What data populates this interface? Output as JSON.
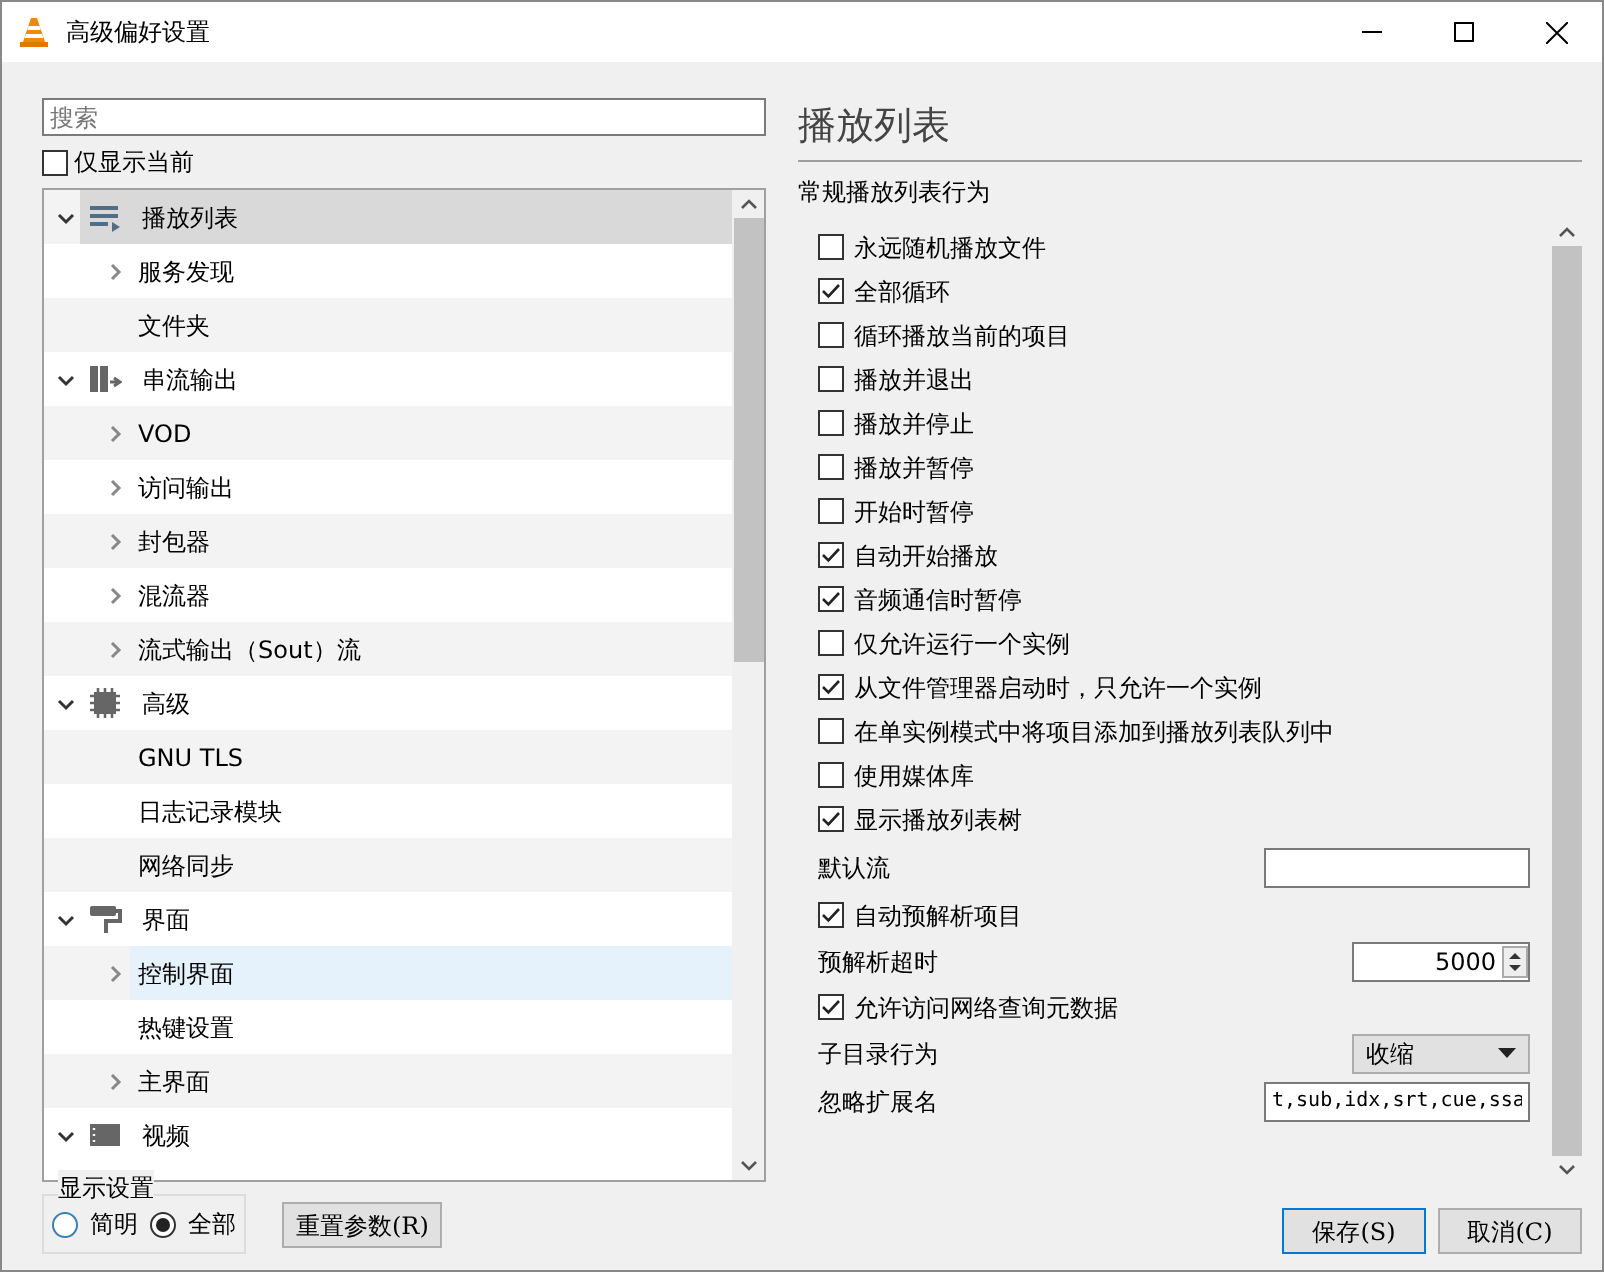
{
  "window": {
    "title": "高级偏好设置"
  },
  "search": {
    "placeholder": "搜索"
  },
  "show_current_only": {
    "label": "仅显示当前",
    "checked": false
  },
  "tree": [
    {
      "label": "播放列表",
      "expanded": true,
      "selected": true,
      "hovered": false,
      "children": [
        {
          "label": "服务发现",
          "expanded": false,
          "selected": false,
          "hovered": false
        },
        {
          "label": "文件夹",
          "selected": false,
          "hovered": false
        }
      ]
    },
    {
      "label": "串流输出",
      "expanded": true,
      "selected": false,
      "hovered": false,
      "children": [
        {
          "label": "VOD",
          "expanded": false,
          "selected": false,
          "hovered": false
        },
        {
          "label": "访问输出",
          "expanded": false,
          "selected": false,
          "hovered": false
        },
        {
          "label": "封包器",
          "expanded": false,
          "selected": false,
          "hovered": false
        },
        {
          "label": "混流器",
          "expanded": false,
          "selected": false,
          "hovered": false
        },
        {
          "label": "流式输出（Sout）流",
          "expanded": false,
          "selected": false,
          "hovered": false
        }
      ]
    },
    {
      "label": "高级",
      "expanded": true,
      "selected": false,
      "hovered": false,
      "children": [
        {
          "label": "GNU TLS",
          "selected": false,
          "hovered": false
        },
        {
          "label": "日志记录模块",
          "selected": false,
          "hovered": false
        },
        {
          "label": "网络同步",
          "selected": false,
          "hovered": false
        }
      ]
    },
    {
      "label": "界面",
      "expanded": true,
      "selected": false,
      "hovered": false,
      "children": [
        {
          "label": "控制界面",
          "expanded": false,
          "selected": false,
          "hovered": true
        },
        {
          "label": "热键设置",
          "selected": false,
          "hovered": false
        },
        {
          "label": "主界面",
          "expanded": false,
          "selected": false,
          "hovered": false
        }
      ]
    },
    {
      "label": "视频",
      "expanded": true,
      "selected": false,
      "hovered": false
    }
  ],
  "display_settings": {
    "title": "显示设置",
    "options": [
      {
        "label": "简明",
        "selected": false
      },
      {
        "label": "全部",
        "selected": true
      }
    ]
  },
  "reset_button": "重置参数(R)",
  "panel": {
    "title": "播放列表",
    "section": "常规播放列表行为",
    "items": [
      {
        "kind": "checkbox",
        "label": "永远随机播放文件",
        "checked": false
      },
      {
        "kind": "checkbox",
        "label": "全部循环",
        "checked": true
      },
      {
        "kind": "checkbox",
        "label": "循环播放当前的项目",
        "checked": false
      },
      {
        "kind": "checkbox",
        "label": "播放并退出",
        "checked": false
      },
      {
        "kind": "checkbox",
        "label": "播放并停止",
        "checked": false
      },
      {
        "kind": "checkbox",
        "label": "播放并暂停",
        "checked": false
      },
      {
        "kind": "checkbox",
        "label": "开始时暂停",
        "checked": false
      },
      {
        "kind": "checkbox",
        "label": "自动开始播放",
        "checked": true
      },
      {
        "kind": "checkbox",
        "label": "音频通信时暂停",
        "checked": true
      },
      {
        "kind": "checkbox",
        "label": "仅允许运行一个实例",
        "checked": false
      },
      {
        "kind": "checkbox",
        "label": "从文件管理器启动时，只允许一个实例",
        "checked": true
      },
      {
        "kind": "checkbox",
        "label": "在单实例模式中将项目添加到播放列表队列中",
        "checked": false
      },
      {
        "kind": "checkbox",
        "label": "使用媒体库",
        "checked": false
      },
      {
        "kind": "checkbox",
        "label": "显示播放列表树",
        "checked": true
      },
      {
        "kind": "text",
        "label": "默认流"
      },
      {
        "kind": "checkbox",
        "label": "自动预解析项目",
        "checked": true
      },
      {
        "kind": "spin",
        "label": "预解析超时",
        "value": "5000"
      },
      {
        "kind": "checkbox",
        "label": "允许访问网络查询元数据",
        "checked": true
      },
      {
        "kind": "select",
        "label": "子目录行为",
        "value": "收缩"
      },
      {
        "kind": "text",
        "label": "忽略扩展名",
        "value": "t,sub,idx,srt,cue,ssa"
      }
    ]
  },
  "buttons": [
    "保存(S)",
    "取消(C)"
  ]
}
